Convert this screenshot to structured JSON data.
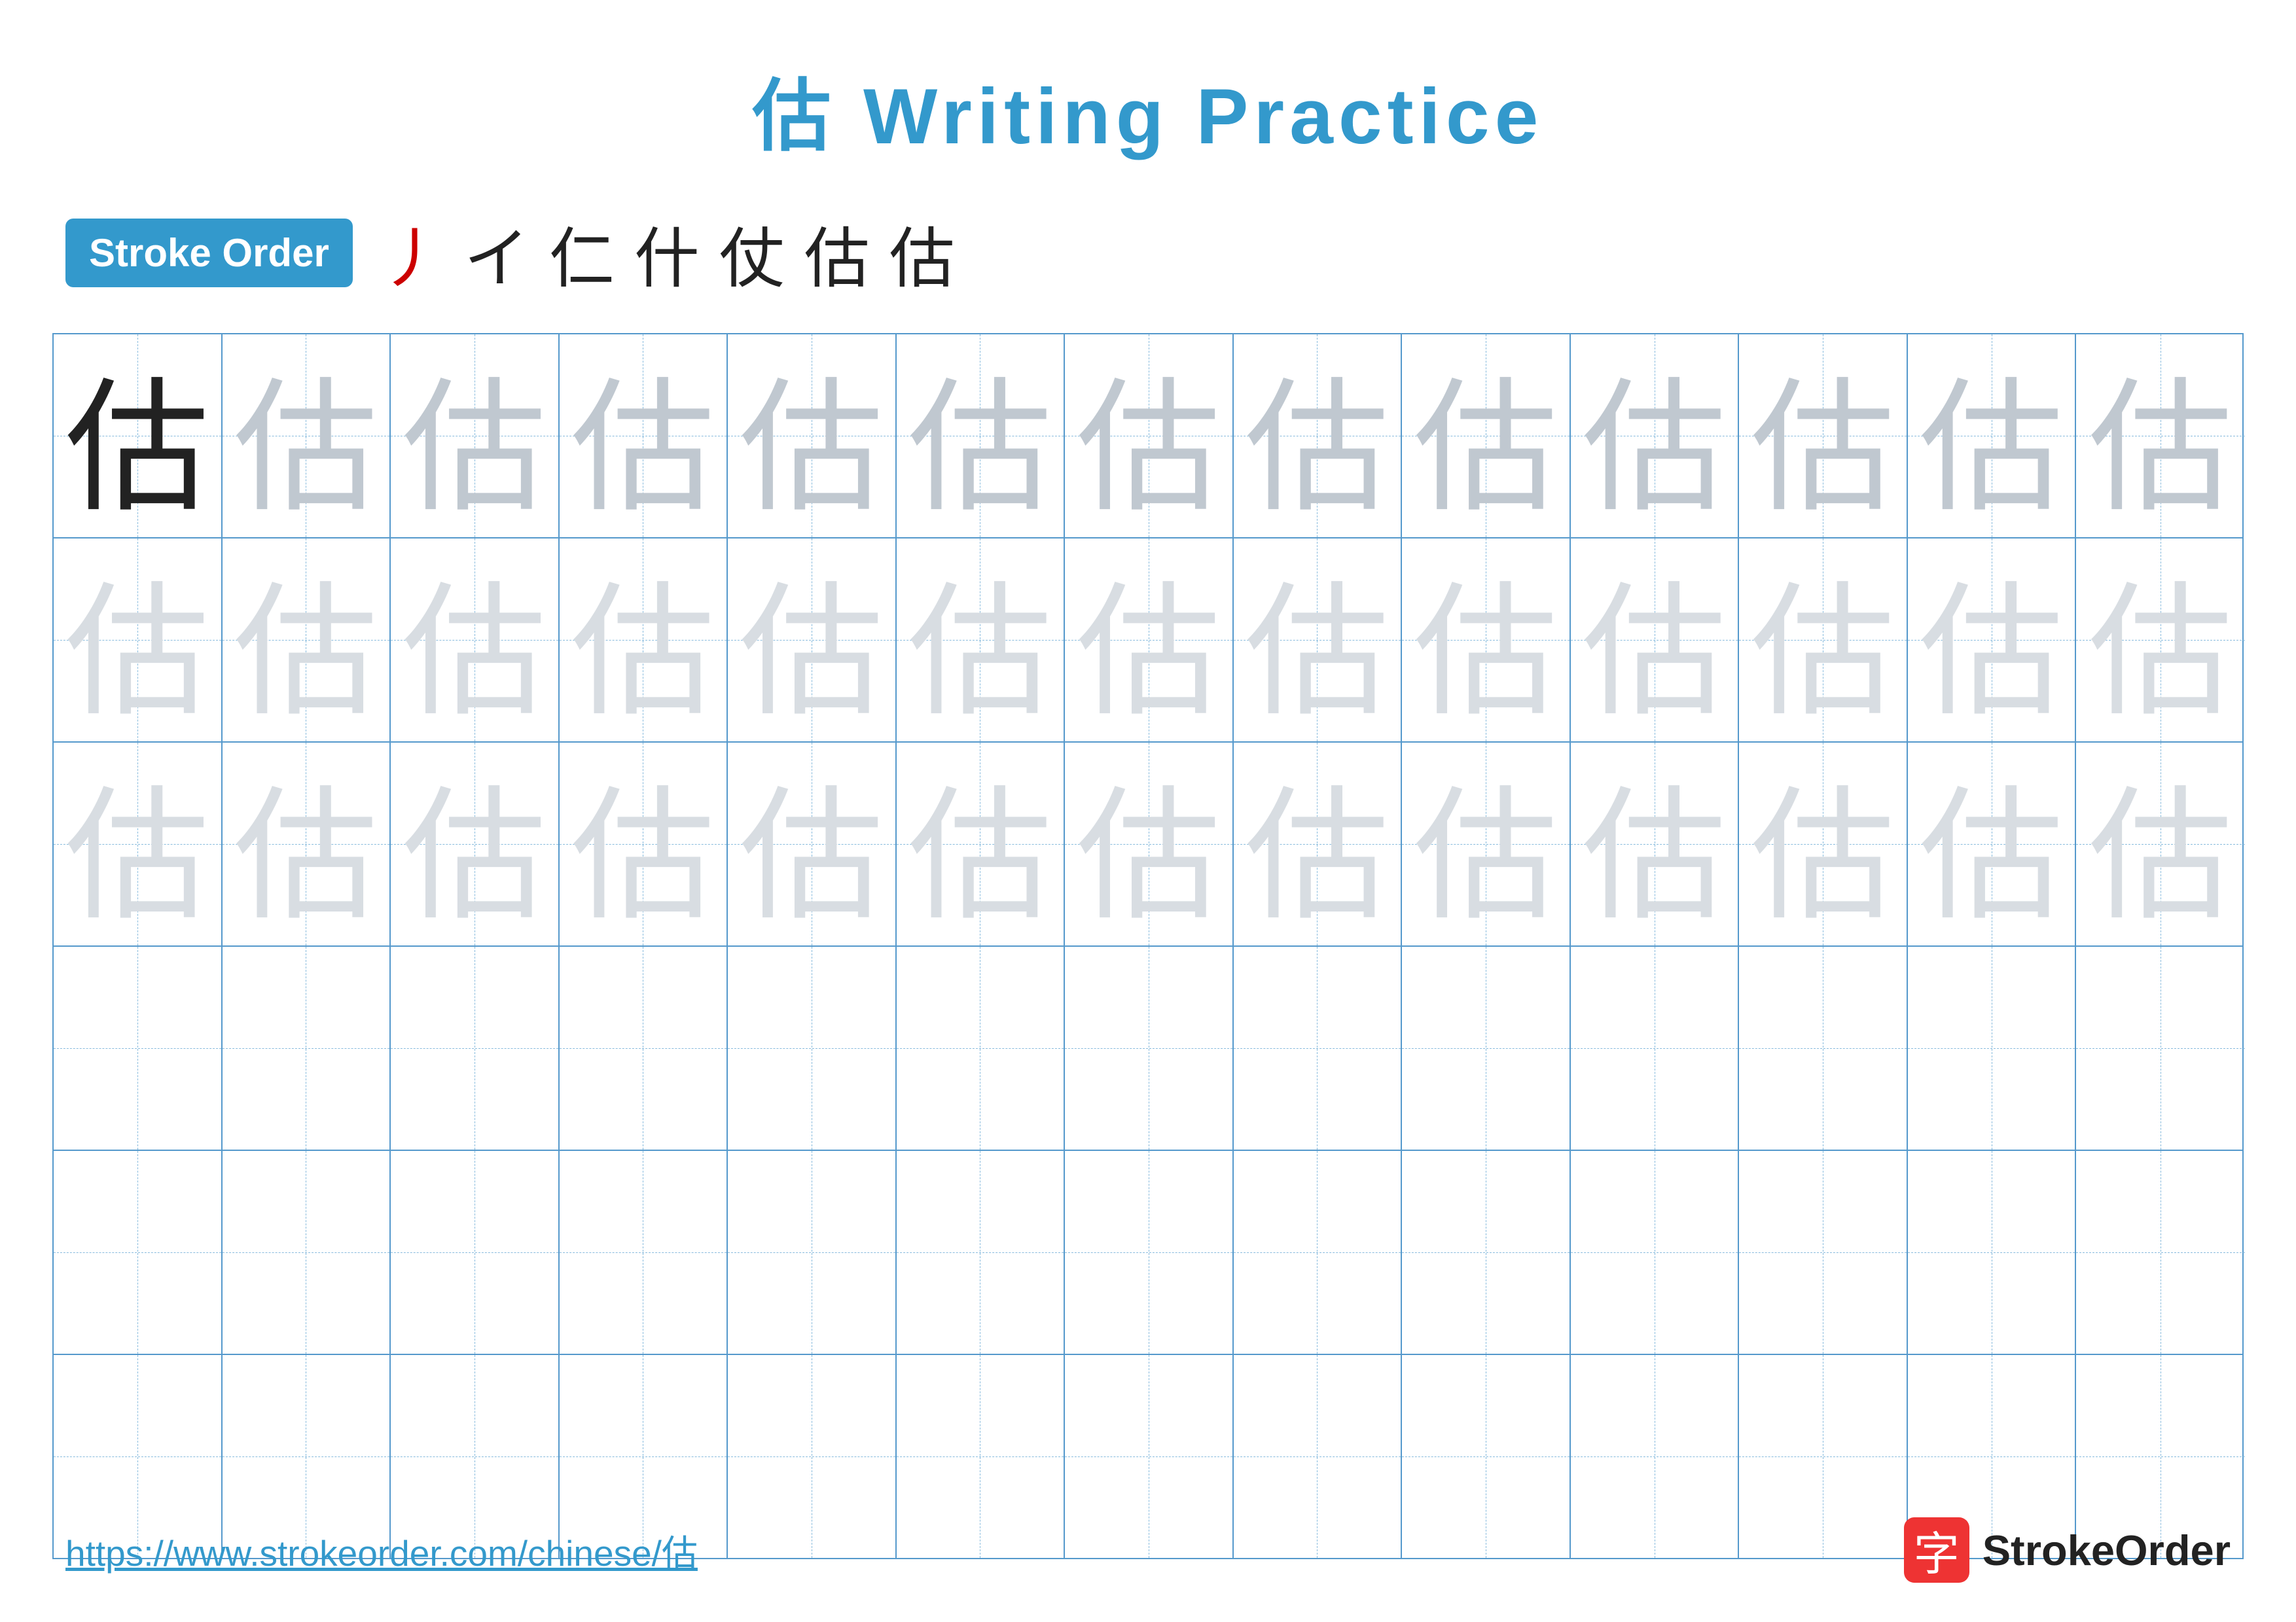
{
  "page": {
    "title": "估 Writing Practice",
    "title_color": "#3399cc",
    "url": "https://www.strokeorder.com/chinese/估",
    "logo_text": "StrokeOrder",
    "logo_icon_char": "字"
  },
  "stroke_order": {
    "badge_label": "Stroke Order",
    "strokes": [
      "丿",
      "イ",
      "仁",
      "什",
      "仗",
      "估",
      "估"
    ]
  },
  "grid": {
    "char": "估",
    "rows": [
      {
        "id": "row1",
        "cells": [
          "dark",
          "medium-gray",
          "medium-gray",
          "medium-gray",
          "medium-gray",
          "medium-gray",
          "medium-gray",
          "medium-gray",
          "medium-gray",
          "medium-gray",
          "medium-gray",
          "medium-gray",
          "medium-gray"
        ]
      },
      {
        "id": "row2",
        "cells": [
          "light-gray",
          "light-gray",
          "light-gray",
          "light-gray",
          "light-gray",
          "light-gray",
          "light-gray",
          "light-gray",
          "light-gray",
          "light-gray",
          "light-gray",
          "light-gray",
          "light-gray"
        ]
      },
      {
        "id": "row3",
        "cells": [
          "light-gray",
          "light-gray",
          "light-gray",
          "light-gray",
          "light-gray",
          "light-gray",
          "light-gray",
          "light-gray",
          "light-gray",
          "light-gray",
          "light-gray",
          "light-gray",
          "light-gray"
        ]
      },
      {
        "id": "row4",
        "cells": [
          "empty",
          "empty",
          "empty",
          "empty",
          "empty",
          "empty",
          "empty",
          "empty",
          "empty",
          "empty",
          "empty",
          "empty",
          "empty"
        ]
      },
      {
        "id": "row5",
        "cells": [
          "empty",
          "empty",
          "empty",
          "empty",
          "empty",
          "empty",
          "empty",
          "empty",
          "empty",
          "empty",
          "empty",
          "empty",
          "empty"
        ]
      },
      {
        "id": "row6",
        "cells": [
          "empty",
          "empty",
          "empty",
          "empty",
          "empty",
          "empty",
          "empty",
          "empty",
          "empty",
          "empty",
          "empty",
          "empty",
          "empty"
        ]
      }
    ]
  }
}
